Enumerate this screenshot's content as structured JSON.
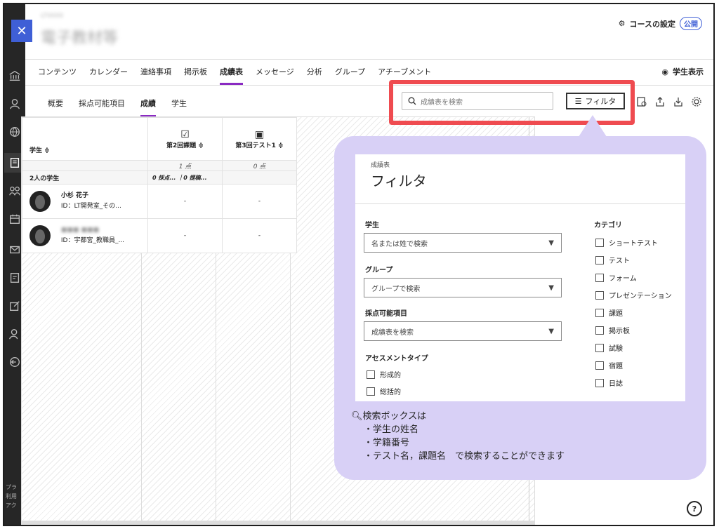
{
  "header": {
    "course_code": "LT0000",
    "course_name": "電子教材等",
    "settings_label": "コースの設定",
    "badge": "公開"
  },
  "rail": {
    "close": "✕",
    "footer": [
      "プラ",
      "利用",
      "アク"
    ]
  },
  "nav": {
    "tabs": [
      "コンテンツ",
      "カレンダー",
      "連絡事項",
      "掲示板",
      "成績表",
      "メッセージ",
      "分析",
      "グループ",
      "アチーブメント"
    ],
    "active": "成績表",
    "student_view": "学生表示"
  },
  "subnav": {
    "tabs": [
      "概要",
      "採点可能項目",
      "成績",
      "学生"
    ],
    "active": "成績",
    "search_placeholder": "成績表を検索",
    "filter_label": "フィルタ"
  },
  "gradebook": {
    "student_col": "学生 ≑",
    "items": [
      {
        "name": "第2回課題 ≑",
        "points": "1 点",
        "stats": "0 採点... ｜0 提稿..."
      },
      {
        "name": "第3回テスト1 ≑",
        "points": "0 点",
        "stats": ""
      }
    ],
    "count_label": "2人の学生",
    "students": [
      {
        "name": "小杉 花子",
        "id": "ID：LT開発室_その...",
        "grades": [
          "-",
          "-"
        ]
      },
      {
        "name": "■■■ ■■■",
        "id": "ID：宇都宮_教職員_...",
        "grades": [
          "-",
          "-"
        ]
      }
    ]
  },
  "filter_panel": {
    "crumb": "成績表",
    "title": "フィルタ",
    "student_label": "学生",
    "student_placeholder": "名または姓で検索",
    "group_label": "グループ",
    "group_placeholder": "グループで検索",
    "item_label": "採点可能項目",
    "item_placeholder": "成績表を検索",
    "assessment_label": "アセスメントタイプ",
    "assessment_types": [
      "形成的",
      "総括的"
    ],
    "category_label": "カテゴリ",
    "categories": [
      "ショートテスト",
      "テスト",
      "フォーム",
      "プレゼンテーション",
      "課題",
      "掲示板",
      "試験",
      "宿題",
      "日誌"
    ]
  },
  "note": {
    "line1": "検索ボックスは",
    "line2": "・学生の姓名",
    "line3": "・学籍番号",
    "line4": "・テスト名，課題名　で検索することができます"
  },
  "colors": {
    "accent": "#8a2ac2",
    "highlight": "#ef4b50",
    "callout": "#d8d0f6",
    "brand": "#3f5fd6"
  }
}
